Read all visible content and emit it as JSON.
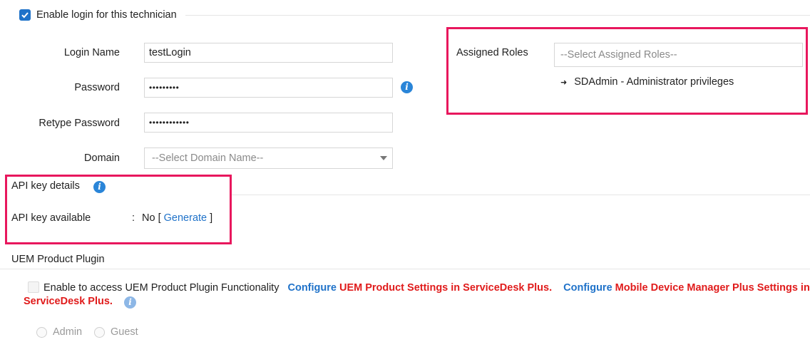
{
  "login_section": {
    "enable_checkbox_label": "Enable login for this technician",
    "enable_checked": true
  },
  "form": {
    "login_name_label": "Login Name",
    "login_name_value": "testLogin",
    "password_label": "Password",
    "password_value": "•••••••••",
    "retype_password_label": "Retype Password",
    "retype_password_value": "••••••••••••",
    "domain_label": "Domain",
    "domain_placeholder": "--Select Domain Name--"
  },
  "roles": {
    "label": "Assigned Roles",
    "placeholder": "--Select Assigned Roles--",
    "assigned": [
      {
        "arrow": "➜",
        "text": "SDAdmin - Administrator privileges"
      }
    ]
  },
  "api_key": {
    "heading": "API key details",
    "available_label": "API key available",
    "separator": ":",
    "value": "No",
    "bracket_open": "[",
    "generate_link": "Generate",
    "bracket_close": "]"
  },
  "uem": {
    "heading": "UEM Product Plugin",
    "checkbox_label": "Enable to access UEM Product Plugin Functionality",
    "configure1": "Configure",
    "configure1_text": "UEM Product Settings in ServiceDesk Plus.",
    "configure2": "Configure",
    "configure2_text": "Mobile Device Manager Plus Settings in",
    "configure2_text_line2": "ServiceDesk Plus.",
    "radio_admin": "Admin",
    "radio_guest": "Guest"
  },
  "colors": {
    "accent": "#1f72c9",
    "highlight": "#e8175d",
    "warning_text": "#e01b1b"
  }
}
